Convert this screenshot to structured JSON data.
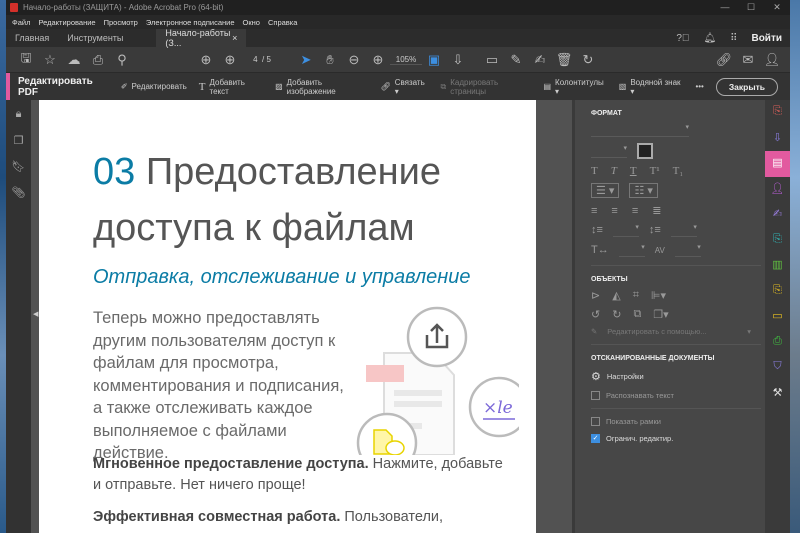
{
  "window": {
    "title": "Начало-работы (ЗАЩИТА) - Adobe Acrobat Pro (64-bit)",
    "controls": [
      "—",
      "☐",
      "✕"
    ]
  },
  "menu": [
    "Файл",
    "Редактирование",
    "Просмотр",
    "Электронное подписание",
    "Окно",
    "Справка"
  ],
  "tabs": {
    "home": "Главная",
    "tools": "Инструменты",
    "doc": "Начало-работы (З...",
    "close": "×",
    "login": "Войти"
  },
  "toolbar": {
    "page_current": "4",
    "page_total": "/ 5",
    "zoom": "105%"
  },
  "editbar": {
    "title": "Редактировать PDF",
    "edit": "Редактировать",
    "add_text": "Добавить текст",
    "add_image": "Добавить изображение",
    "link": "Связать ▾",
    "crop": "Кадрировать страницы",
    "headers": "Колонтитулы ▾",
    "watermark": "Водяной знак ▾",
    "more": "•••",
    "close": "Закрыть"
  },
  "page": {
    "num": "03",
    "title1": " Предоставление",
    "title2": "доступа к файлам",
    "subtitle": "Отправка, отслеживание и управление",
    "body": "Теперь можно предоставлять другим пользователям доступ к файлам для просмотра, комментирования и подписания, а также отслеживать каждое выполняемое с файлами действие.",
    "p1_bold": "Мгновенное предоставление доступа.",
    "p1_text": " Нажмите, добавьте и отправьте. Нет ничего проще!",
    "p2_bold": "Эффективная совместная работа.",
    "p2_text": " Пользователи,"
  },
  "panel": {
    "format": "ФОРМАТ",
    "objects": "ОБЪЕКТЫ",
    "edit_with": "Редактировать с помощью...",
    "scanned": "ОТСКАНИРОВАННЫЕ ДОКУМЕНТЫ",
    "settings": "Настройки",
    "recognize": "Распознавать текст",
    "show_frames": "Показать рамки",
    "restrict": "Огранич. редактир.",
    "restrict_checked": true,
    "recognize_checked": false,
    "show_frames_checked": false
  },
  "colors": {
    "accent": "#e25a9f",
    "blue": "#0b7ca5"
  }
}
